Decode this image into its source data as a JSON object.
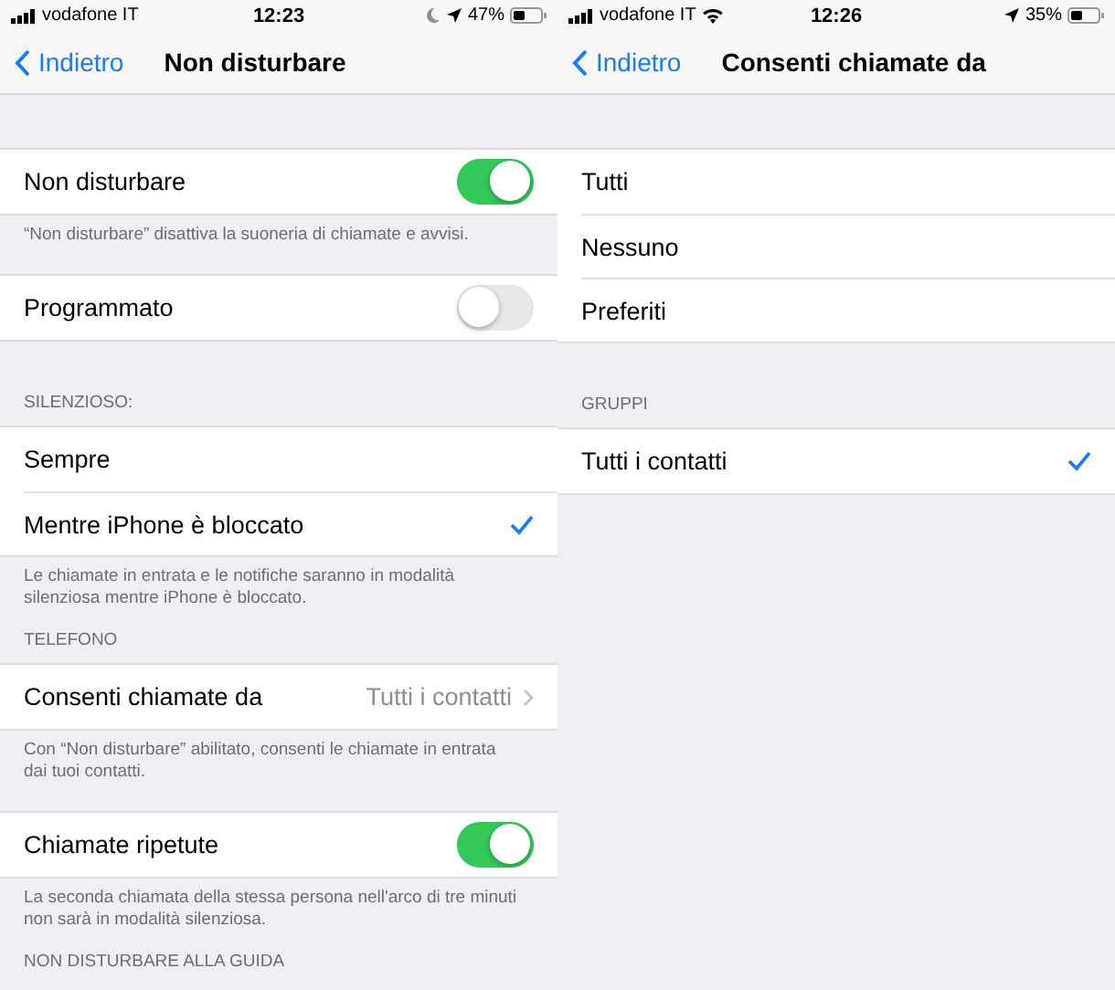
{
  "screens": [
    {
      "status_bar": {
        "carrier": "vodafone IT",
        "time": "12:23",
        "battery": "47%",
        "indicators": [
          {
            "kind": "moon"
          },
          {
            "kind": "location"
          }
        ]
      },
      "nav": {
        "back": "Indietro",
        "title": "Non disturbare"
      },
      "sections": [
        {
          "rows": [
            {
              "kind": "toggle",
              "label": "Non disturbare",
              "on": true
            }
          ],
          "footer": "“Non disturbare” disattiva la suoneria di chiamate e avvisi."
        },
        {
          "rows": [
            {
              "kind": "toggle",
              "label": "Programmato",
              "on": false
            }
          ]
        },
        {
          "header": "SILENZIOSO:",
          "rows": [
            {
              "kind": "check",
              "label": "Sempre",
              "checked": false
            },
            {
              "kind": "check",
              "label": "Mentre iPhone è bloccato",
              "checked": true
            }
          ],
          "footer": "Le chiamate in entrata e le notifiche saranno in modalità silenziosa mentre iPhone è bloccato."
        },
        {
          "header": "TELEFONO",
          "rows": [
            {
              "kind": "value",
              "label": "Consenti chiamate da",
              "value": "Tutti i contatti"
            }
          ],
          "footer": "Con “Non disturbare” abilitato, consenti le chiamate in entrata dai tuoi contatti."
        },
        {
          "rows": [
            {
              "kind": "toggle",
              "label": "Chiamate ripetute",
              "on": true
            }
          ],
          "footer": "La seconda chiamata della stessa persona nell'arco di tre minuti non sarà in modalità silenziosa."
        },
        {
          "header": "NON DISTURBARE ALLA GUIDA"
        }
      ]
    },
    {
      "status_bar": {
        "carrier": "vodafone IT",
        "time": "12:26",
        "battery": "35%",
        "indicators": [
          {
            "kind": "wifi"
          },
          {
            "kind": "location"
          }
        ]
      },
      "nav": {
        "back": "Indietro",
        "title": "Consenti chiamate da"
      },
      "sections": [
        {
          "rows": [
            {
              "kind": "check",
              "label": "Tutti",
              "checked": false
            },
            {
              "kind": "check",
              "label": "Nessuno",
              "checked": false
            },
            {
              "kind": "check",
              "label": "Preferiti",
              "checked": false
            }
          ]
        },
        {
          "header": "GRUPPI",
          "rows": [
            {
              "kind": "check",
              "label": "Tutti i contatti",
              "checked": true
            }
          ]
        }
      ]
    }
  ]
}
